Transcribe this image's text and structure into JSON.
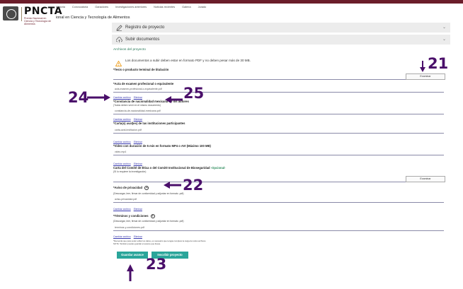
{
  "header": {
    "logo_text": "PNCTA",
    "logo_subtitle": "Premio Nacional en Ciencia y Tecnología de Alimentos",
    "nav": [
      "Historia",
      "Convocatoria",
      "Ganadores",
      "Investigaciones anteriores",
      "Noticias recientes",
      "Galería",
      "Jurado"
    ],
    "page_title": "ional en Ciencia y Tecnología de Alimentos"
  },
  "panels": {
    "registro": "Registro de proyecto",
    "subir": "Subir documentos"
  },
  "section_title": "Archivos del proyecto",
  "warning": "Los documentos a subir deben estar en formato PDF y no deben pesar más de 30 MB.",
  "fields": {
    "tesis": {
      "label": "*Tesis o producto terminal de titulación",
      "button": "Examinar"
    },
    "acta": {
      "label": "*Acta de examen profesional o equivalente",
      "file": "acta-examen-profesional-o-equivalente.pdf"
    },
    "constancia": {
      "label": "*Constancia de nacionalidad mexicana de los autores",
      "sublabel": "(Todos deben venir en el mismo documento)",
      "file": "constancia-de-nacionalidad-mexicana.pdf"
    },
    "cartas": {
      "label": "*Carta(s) aval(es) de las instituciones participantes",
      "file": "carta-aval-institucion.pdf"
    },
    "video": {
      "label": "*Video con duración de 5 min en formato MP4 o AVI (Máximo 100 MB)",
      "file": "video.mp4"
    },
    "etica": {
      "label": "Carta del Comité de Ética o del Comité Institucional de Bioseguridad",
      "optional": "-Opcional-",
      "sublabel": "(Si lo requiere la investigación)",
      "button": "Examinar"
    },
    "aviso": {
      "label": "*Aviso de privacidad",
      "sublabel": "(Descargar, leer, firmar de conformidad y adjuntar en formato .pdf)",
      "file": "aviso-privacidad.pdf"
    },
    "terminos": {
      "label": "*Términos y condiciones",
      "sublabel": "(Descargar, leer, firmar de conformidad y adjuntar en formato .pdf)",
      "file": "terminos-y-condiciones.pdf"
    }
  },
  "links": {
    "change": "Cambiar archivo",
    "delete": "Eliminar"
  },
  "notes": {
    "line1": "*Recuerda que para poder editar tus datos, es necesario que tengas completo la carga de todos archivos.",
    "line2": "NOTA: También puedes guardar el avance que llevas."
  },
  "buttons": {
    "save": "Guardar avance",
    "submit": "Inscribir proyecto"
  },
  "annotations": [
    "21",
    "22",
    "23",
    "24",
    "25"
  ],
  "colors": {
    "brand": "#6b1d2a",
    "accent": "#2aa59a",
    "annotation": "#4a0f6a",
    "link": "#3a3ab0",
    "warning": "#f0a020"
  }
}
